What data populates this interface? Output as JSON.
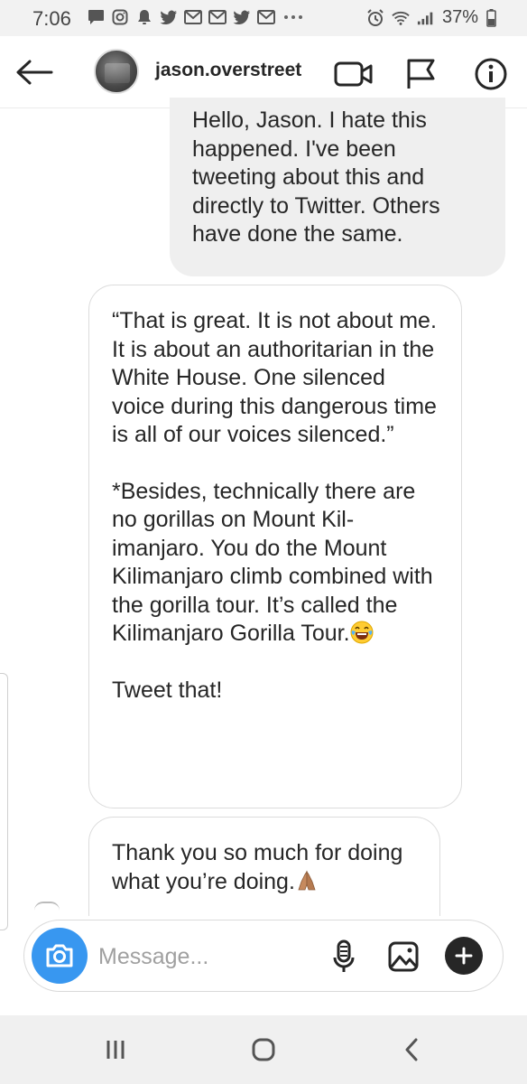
{
  "status_bar": {
    "time": "7:06",
    "battery": "37%",
    "left_icons": [
      "message-icon",
      "instagram-icon",
      "notification-bell-icon",
      "twitter-icon",
      "gmail-icon",
      "gmail-icon",
      "twitter-icon",
      "gmail-icon",
      "more-dots-icon"
    ],
    "right_icons": [
      "alarm-icon",
      "wifi-icon",
      "signal-icon",
      "battery-icon"
    ]
  },
  "header": {
    "username": "jason.overstreet",
    "icons": [
      "back-arrow-icon",
      "video-call-icon",
      "flag-icon",
      "info-icon"
    ]
  },
  "messages": [
    {
      "direction": "outgoing",
      "text": "Hello, Jason. I hate this happened. I've been tweeting about this and directly to Twitter. Others have done the same."
    },
    {
      "direction": "incoming",
      "paragraph_1": "“That is great. It is not about me. It is about an authoritarian in the White House. One silenced voice during this dangerous time is all of our voices silenced.”",
      "paragraph_2": "*Besides, technically there are no gorillas on Mount Kil-imanjaro. You do the Mount Kilimanjaro climb combined with the gorilla tour. It’s called the Kilimanjaro Gorilla Tour.",
      "paragraph_2_emoji": "laughing-tears-emoji",
      "paragraph_3": "Tweet that!"
    },
    {
      "direction": "incoming",
      "text": "Thank you so much for doing what you’re doing.",
      "emoji": "praying-hands-emoji"
    }
  ],
  "composer": {
    "placeholder": "Message...",
    "icons": [
      "camera-icon",
      "microphone-icon",
      "gallery-icon",
      "plus-icon"
    ]
  },
  "nav_bar": {
    "icons": [
      "recent-apps-icon",
      "home-icon",
      "back-icon"
    ]
  },
  "colors": {
    "accent_blue": "#3897f0",
    "outgoing_bubble": "#efefef",
    "text": "#262626"
  }
}
